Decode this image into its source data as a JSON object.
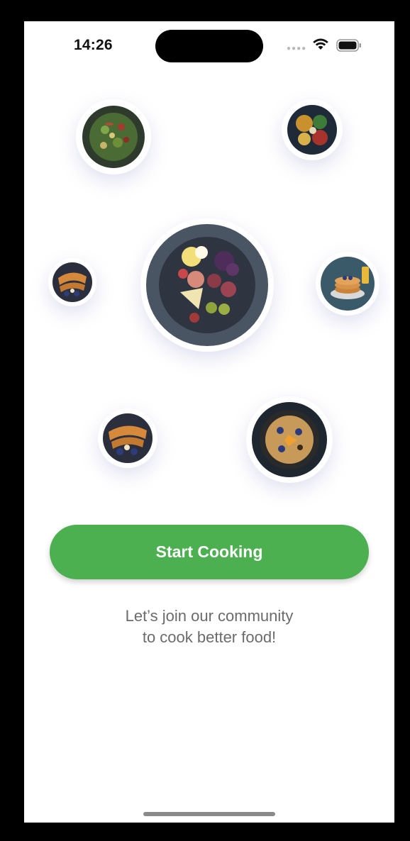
{
  "status_bar": {
    "time": "14:26",
    "signal_icon": "cellular-signal-icon",
    "wifi_icon": "wifi-icon",
    "battery_icon": "battery-icon"
  },
  "food_images": [
    {
      "name": "salad-bowl-image"
    },
    {
      "name": "spice-bowl-image"
    },
    {
      "name": "crepes-plate-image"
    },
    {
      "name": "charcuterie-platter-image"
    },
    {
      "name": "pancake-stack-image"
    },
    {
      "name": "crepes-plate-image-2"
    },
    {
      "name": "porridge-skillet-image"
    }
  ],
  "cta": {
    "label": "Start Cooking",
    "color": "#4caf50"
  },
  "tagline": {
    "line1": "Let’s join our community",
    "line2": "to cook better food!"
  }
}
